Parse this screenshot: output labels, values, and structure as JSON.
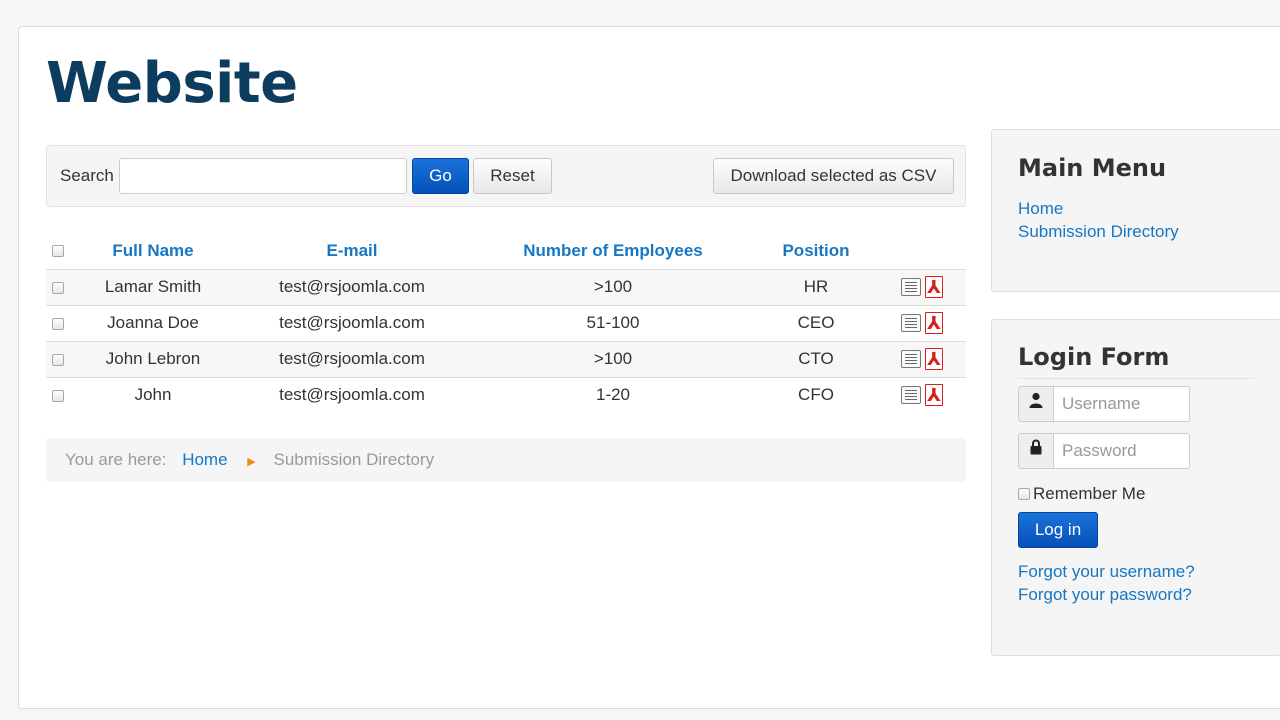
{
  "site": {
    "title": "Website"
  },
  "search": {
    "label": "Search",
    "value": "",
    "placeholder": "",
    "go_label": "Go",
    "reset_label": "Reset",
    "csv_label": "Download selected as CSV"
  },
  "table": {
    "headers": [
      "Full Name",
      "E-mail",
      "Number of Employees",
      "Position"
    ],
    "rows": [
      {
        "name": "Lamar Smith",
        "email": "test@rsjoomla.com",
        "employees": ">100",
        "position": "HR"
      },
      {
        "name": "Joanna Doe",
        "email": "test@rsjoomla.com",
        "employees": "51-100",
        "position": "CEO"
      },
      {
        "name": "John Lebron",
        "email": "test@rsjoomla.com",
        "employees": ">100",
        "position": "CTO"
      },
      {
        "name": "John",
        "email": "test@rsjoomla.com",
        "employees": "1-20",
        "position": "CFO"
      }
    ]
  },
  "breadcrumb": {
    "prefix": "You are here:",
    "home": "Home",
    "current": "Submission Directory"
  },
  "main_menu": {
    "title": "Main Menu",
    "items": [
      "Home",
      "Submission Directory"
    ]
  },
  "login": {
    "title": "Login Form",
    "username_placeholder": "Username",
    "password_placeholder": "Password",
    "remember_label": "Remember Me",
    "submit_label": "Log in",
    "forgot_username": "Forgot your username?",
    "forgot_password": "Forgot your password?"
  },
  "colors": {
    "link": "#1677c4",
    "primary_button": "#0551b9",
    "title": "#0d3d5e",
    "breadcrumb_separator": "#f28b1e"
  },
  "icons": {
    "details": "list-icon",
    "pdf": "pdf-icon",
    "username": "user-icon",
    "password": "lock-icon",
    "breadcrumb_separator": "chevron-right-icon"
  }
}
